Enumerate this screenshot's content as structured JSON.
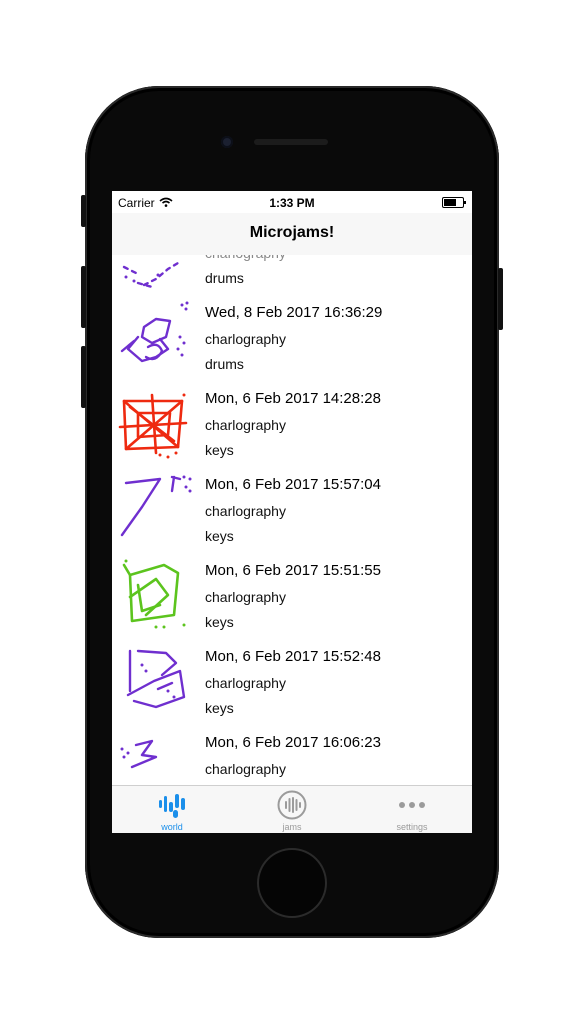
{
  "status_bar": {
    "carrier": "Carrier",
    "time": "1:33 PM"
  },
  "navbar": {
    "title": "Microjams!"
  },
  "rows": [
    {
      "date": "",
      "author": "charlography",
      "instrument": "drums",
      "color": "#6f2fcf"
    },
    {
      "date": "Wed, 8 Feb 2017 16:36:29",
      "author": "charlography",
      "instrument": "drums",
      "color": "#6f2fcf"
    },
    {
      "date": "Mon, 6 Feb 2017 14:28:28",
      "author": "charlography",
      "instrument": "keys",
      "color": "#ee2a10"
    },
    {
      "date": "Mon, 6 Feb 2017 15:57:04",
      "author": "charlography",
      "instrument": "keys",
      "color": "#6f2fcf"
    },
    {
      "date": "Mon, 6 Feb 2017 15:51:55",
      "author": "charlography",
      "instrument": "keys",
      "color": "#5cc41e"
    },
    {
      "date": "Mon, 6 Feb 2017 15:52:48",
      "author": "charlography",
      "instrument": "keys",
      "color": "#6f2fcf"
    },
    {
      "date": "Mon, 6 Feb 2017 16:06:23",
      "author": "charlography",
      "instrument": "",
      "color": "#6f2fcf"
    }
  ],
  "tabs": [
    {
      "label": "world",
      "icon": "world-waveform-icon",
      "active": true
    },
    {
      "label": "jams",
      "icon": "jams-circle-icon",
      "active": false
    },
    {
      "label": "settings",
      "icon": "more-dots-icon",
      "active": false
    }
  ],
  "colors": {
    "accent": "#1b8fea",
    "inactive": "#9b9b9b"
  }
}
